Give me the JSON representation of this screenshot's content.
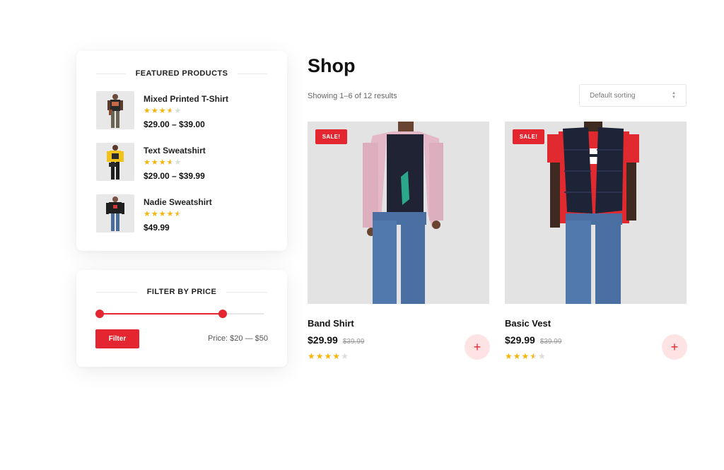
{
  "featured": {
    "title": "FEATURED PRODUCTS",
    "items": [
      {
        "name": "Mixed Printed T-Shirt",
        "price": "$29.00 – $39.00",
        "rating": 3.5
      },
      {
        "name": "Text Sweatshirt",
        "price": "$29.00 – $39.99",
        "rating": 3.5
      },
      {
        "name": "Nadie Sweatshirt",
        "price": "$49.99",
        "rating": 4.5
      }
    ]
  },
  "filter": {
    "title": "FILTER BY PRICE",
    "button_label": "Filter",
    "price_label": "Price: $20 — $50",
    "range_min": 0.0,
    "range_max": 0.75
  },
  "shop": {
    "title": "Shop",
    "results_text": "Showing 1–6 of 12 results",
    "sort_selected": "Default sorting"
  },
  "products": [
    {
      "name": "Band Shirt",
      "badge": "SALE!",
      "price": "$29.99",
      "old_price": "$39.99",
      "rating": 4,
      "add_label": "+"
    },
    {
      "name": "Basic Vest",
      "badge": "SALE!",
      "price": "$29.99",
      "old_price": "$39.99",
      "rating": 3.5,
      "add_label": "+"
    }
  ],
  "colors": {
    "accent": "#e3262f",
    "star": "#f5b50a",
    "add_button_bg": "#fde3e4"
  },
  "icons": {
    "sort": "sort-arrows-icon",
    "add": "plus-icon",
    "star": "star-icon"
  }
}
